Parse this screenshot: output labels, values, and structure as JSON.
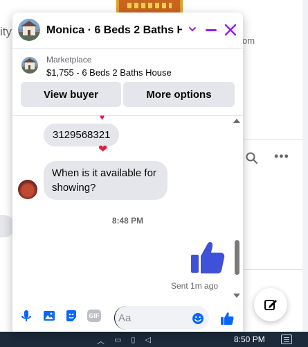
{
  "background": {
    "left_partial_text": "ity",
    "right_partial_text": "om"
  },
  "chat": {
    "header": {
      "title": "Monica · 6 Beds 2 Baths H..."
    },
    "marketplace": {
      "label": "Marketplace",
      "listing": "$1,755 - 6 Beds 2 Baths House"
    },
    "buttons": {
      "view_buyer": "View buyer",
      "more_options": "More options"
    },
    "messages": [
      {
        "text": "3129568321",
        "reaction": "❤"
      },
      {
        "text": "When is it available for showing?"
      }
    ],
    "time_separator": "8:48 PM",
    "sent_status": "Sent 1m ago",
    "composer": {
      "placeholder": "Aa",
      "gif_label": "GIF"
    }
  },
  "taskbar": {
    "time": "8:50 PM"
  },
  "colors": {
    "messenger_blue": "#0866ff",
    "thumb_blue": "#3f51d8",
    "window_controls": "#9b1fe8",
    "heart_red": "#e41e3f",
    "bubble_gray": "#e4e6eb"
  },
  "icons": [
    "chevron-down-icon",
    "minimize-icon",
    "close-icon",
    "microphone-icon",
    "image-icon",
    "sticker-icon",
    "gif-icon",
    "emoji-icon",
    "thumbs-up-icon",
    "compose-icon",
    "search-icon",
    "more-icon"
  ]
}
